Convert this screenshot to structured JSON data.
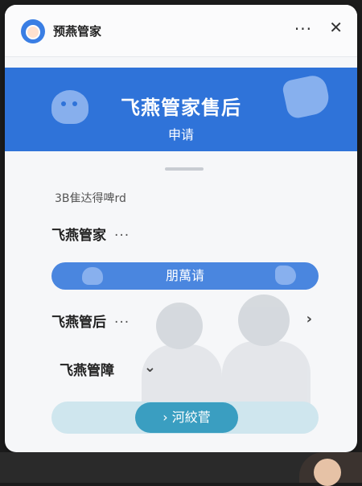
{
  "app": {
    "title": "预燕管家",
    "more_icon": "more-dots-icon",
    "close_icon": "close-icon"
  },
  "banner": {
    "title": "飞燕管家售后",
    "subtitle": "申请",
    "brand_color": "#2f73d9"
  },
  "section": {
    "label": "3B隹达得啤rd"
  },
  "rows": {
    "first": {
      "label": "飞燕管家",
      "dots": "···"
    },
    "second": {
      "label": "飞燕管后",
      "dots": "···",
      "chevron": "›"
    },
    "third": {
      "label": "飞燕管障",
      "chevron": "⌄"
    }
  },
  "pill": {
    "label": "朋萬请",
    "color": "#4a86df"
  },
  "bottom": {
    "button_label": "河絞菅",
    "arrow": "›",
    "color": "#3a9ec1"
  }
}
